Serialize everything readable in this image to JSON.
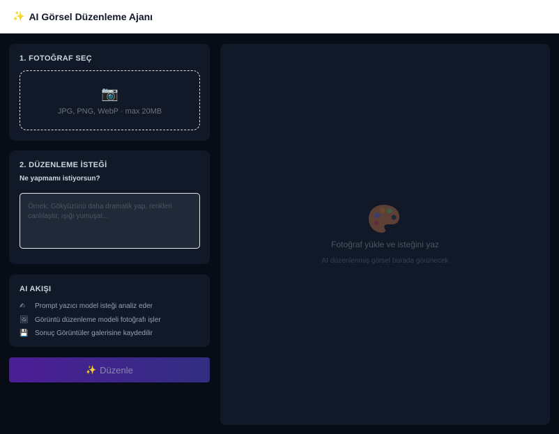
{
  "header": {
    "icon": "sparkles-icon",
    "title": "AI Görsel Düzenleme Ajanı"
  },
  "photo": {
    "section_title": "1. FOTOĞRAF SEÇ",
    "camera_icon": "camera-icon",
    "hint": "JPG, PNG, WebP · max 20MB"
  },
  "edit": {
    "section_title": "2. DÜZENLEME İSTEĞİ",
    "subtitle": "Ne yapmamı istiyorsun?",
    "value": "",
    "placeholder": "Örnek: Gökyüzünü daha dramatik yap, renkleri canlılaştır, ışığı yumuşat..."
  },
  "flow": {
    "section_title": "AI AKIŞI",
    "items": [
      {
        "icon": "writing-hand-icon",
        "text": "Prompt yazıcı model isteği analiz eder"
      },
      {
        "icon": "picture-icon",
        "text": "Görüntü düzenleme modeli fotoğrafı işler"
      },
      {
        "icon": "floppy-disk-icon",
        "text": "Sonuç Görüntüler galerisine kaydedilir"
      }
    ]
  },
  "action": {
    "label": "Düzenle",
    "icon": "sparkles-icon"
  },
  "preview": {
    "icon": "palette-icon",
    "title": "Fotoğraf yükle ve isteğini yaz",
    "subtitle": "AI düzenlenmiş görsel burada görünecek"
  },
  "colors": {
    "background": "#080c16",
    "card": "#111827",
    "accent_start": "#4c1d95",
    "accent_end": "#312e81"
  }
}
